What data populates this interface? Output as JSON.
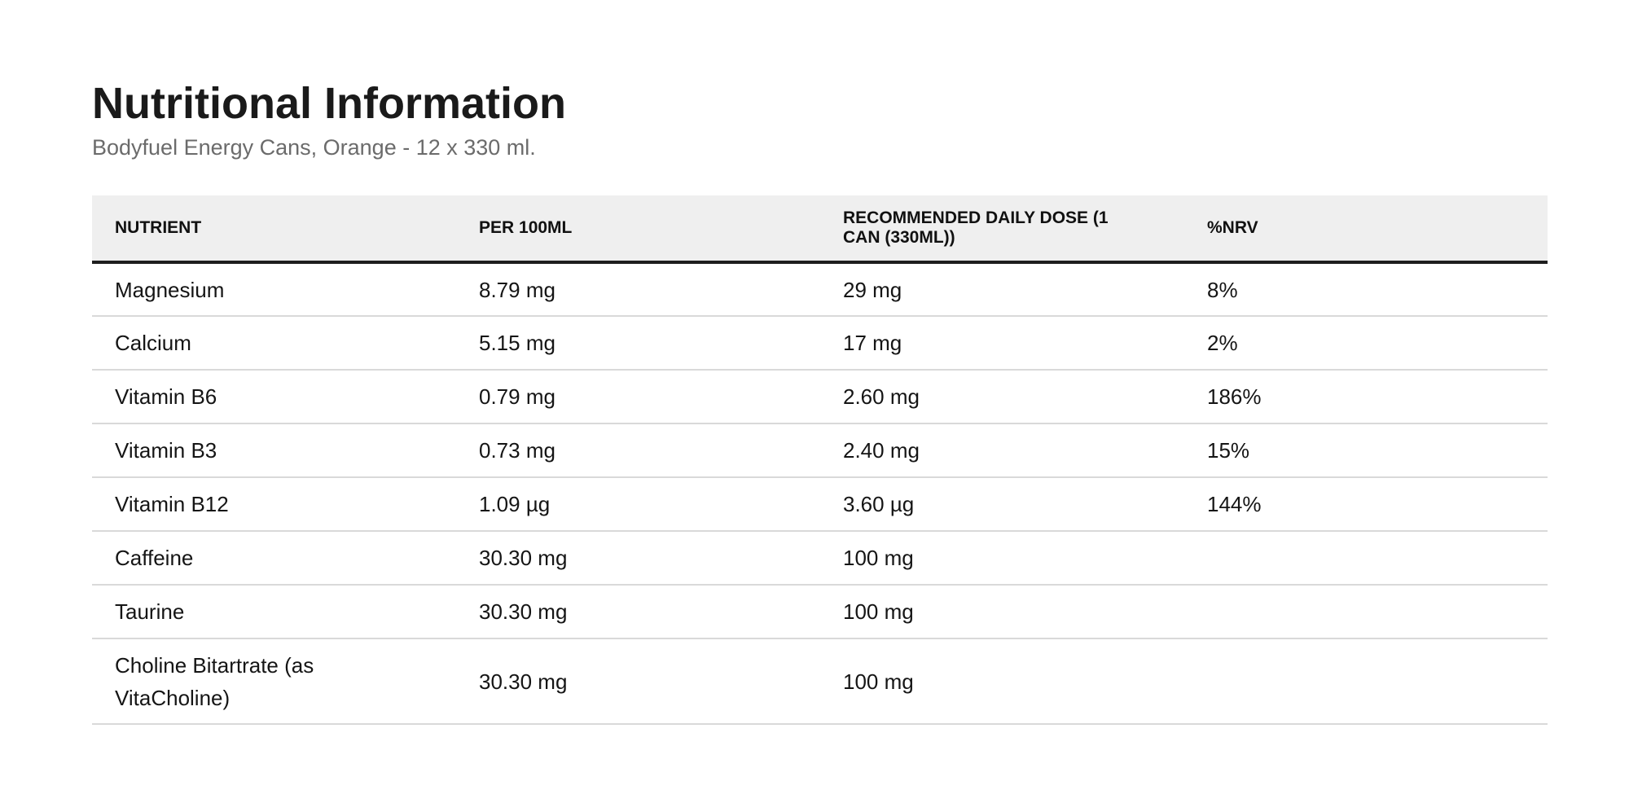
{
  "header": {
    "title": "Nutritional Information",
    "subtitle": "Bodyfuel Energy Cans, Orange - 12 x 330 ml."
  },
  "table": {
    "columns": [
      "NUTRIENT",
      "PER 100ML",
      "RECOMMENDED DAILY DOSE (1 CAN (330ML))",
      "%NRV"
    ],
    "rows": [
      {
        "nutrient": "Magnesium",
        "per100": "8.79 mg",
        "dose": "29 mg",
        "nrv": "8%"
      },
      {
        "nutrient": "Calcium",
        "per100": "5.15 mg",
        "dose": "17 mg",
        "nrv": "2%"
      },
      {
        "nutrient": "Vitamin B6",
        "per100": "0.79 mg",
        "dose": "2.60 mg",
        "nrv": "186%"
      },
      {
        "nutrient": "Vitamin B3",
        "per100": "0.73 mg",
        "dose": "2.40 mg",
        "nrv": "15%"
      },
      {
        "nutrient": "Vitamin B12",
        "per100": "1.09 µg",
        "dose": "3.60 µg",
        "nrv": "144%"
      },
      {
        "nutrient": "Caffeine",
        "per100": "30.30 mg",
        "dose": "100 mg",
        "nrv": ""
      },
      {
        "nutrient": "Taurine",
        "per100": "30.30 mg",
        "dose": "100 mg",
        "nrv": ""
      },
      {
        "nutrient": "Choline Bitartrate (as VitaCholine)",
        "per100": "30.30 mg",
        "dose": "100 mg",
        "nrv": ""
      }
    ]
  },
  "colors": {
    "header_bg": "#efefef",
    "header_rule": "#1e1e1e",
    "row_rule": "#d9d9d9",
    "subtitle": "#6b6b6b"
  }
}
